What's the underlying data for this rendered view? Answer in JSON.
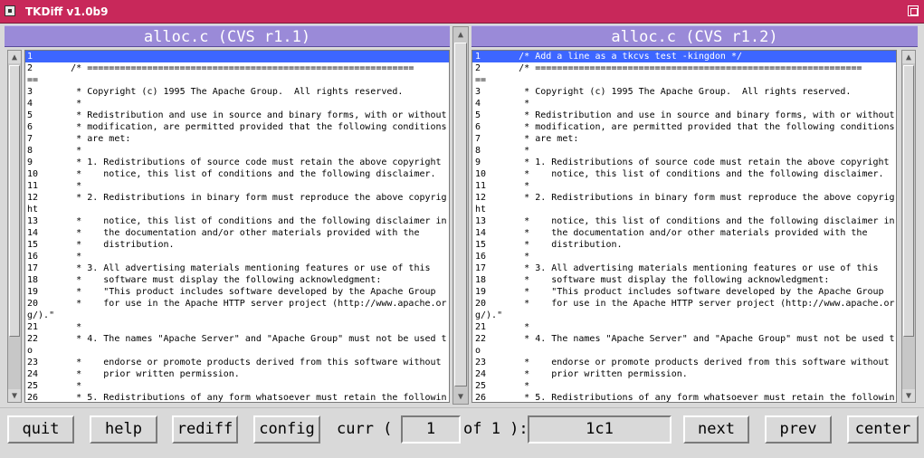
{
  "window": {
    "title": "TKDiff v1.0b9"
  },
  "left_pane": {
    "header": "alloc.c (CVS r1.1)",
    "lines": [
      "1",
      "2       /* ============================================================",
      "==",
      "3        * Copyright (c) 1995 The Apache Group.  All rights reserved.",
      "4        *",
      "5        * Redistribution and use in source and binary forms, with or without",
      "6        * modification, are permitted provided that the following conditions",
      "7        * are met:",
      "8        *",
      "9        * 1. Redistributions of source code must retain the above copyright",
      "10       *    notice, this list of conditions and the following disclaimer.",
      "11       *",
      "12       * 2. Redistributions in binary form must reproduce the above copyrig",
      "ht",
      "13       *    notice, this list of conditions and the following disclaimer in",
      "14       *    the documentation and/or other materials provided with the",
      "15       *    distribution.",
      "16       *",
      "17       * 3. All advertising materials mentioning features or use of this",
      "18       *    software must display the following acknowledgment:",
      "19       *    \"This product includes software developed by the Apache Group",
      "20       *    for use in the Apache HTTP server project (http://www.apache.or",
      "g/).\"",
      "21       *",
      "22       * 4. The names \"Apache Server\" and \"Apache Group\" must not be used t",
      "o",
      "23       *    endorse or promote products derived from this software without",
      "24       *    prior written permission.",
      "25       *",
      "26       * 5. Redistributions of any form whatsoever must retain the followin"
    ]
  },
  "right_pane": {
    "header": "alloc.c (CVS r1.2)",
    "lines": [
      "1       /* Add a line as a tkcvs test -kingdon */",
      "2       /* ============================================================",
      "==",
      "3        * Copyright (c) 1995 The Apache Group.  All rights reserved.",
      "4        *",
      "5        * Redistribution and use in source and binary forms, with or without",
      "6        * modification, are permitted provided that the following conditions",
      "7        * are met:",
      "8        *",
      "9        * 1. Redistributions of source code must retain the above copyright",
      "10       *    notice, this list of conditions and the following disclaimer.",
      "11       *",
      "12       * 2. Redistributions in binary form must reproduce the above copyrig",
      "ht",
      "13       *    notice, this list of conditions and the following disclaimer in",
      "14       *    the documentation and/or other materials provided with the",
      "15       *    distribution.",
      "16       *",
      "17       * 3. All advertising materials mentioning features or use of this",
      "18       *    software must display the following acknowledgment:",
      "19       *    \"This product includes software developed by the Apache Group",
      "20       *    for use in the Apache HTTP server project (http://www.apache.or",
      "g/).\"",
      "21       *",
      "22       * 4. The names \"Apache Server\" and \"Apache Group\" must not be used t",
      "o",
      "23       *    endorse or promote products derived from this software without",
      "24       *    prior written permission.",
      "25       *",
      "26       * 5. Redistributions of any form whatsoever must retain the followin"
    ]
  },
  "toolbar": {
    "quit": "quit",
    "help": "help",
    "rediff": "rediff",
    "config": "config",
    "curr_label": "curr (",
    "curr_value": "1",
    "of_label": "of 1 ):",
    "diff_location": "1c1",
    "next": "next",
    "prev": "prev",
    "center": "center"
  },
  "colors": {
    "title_bar": "#c8285a",
    "pane_header": "#9a8ad8",
    "selected_line": "#3d66ff"
  }
}
